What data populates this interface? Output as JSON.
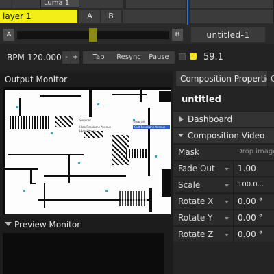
{
  "layer_strip": {
    "clip_label": "Luma 1",
    "layer_name": "layer 1",
    "button_a": "A",
    "button_b": "B"
  },
  "crossfader": {
    "side_a": "A",
    "side_b": "B",
    "composition_name": "untitled-1"
  },
  "tempo": {
    "bpm_label": "BPM",
    "bpm_value": "120.000",
    "minus": "-",
    "plus": "+",
    "tap": "Tap",
    "resync": "Resync",
    "pause": "Pause",
    "fps": "59.1"
  },
  "output_monitor": {
    "title": "Output Monitor",
    "menu_items": [
      "Services",
      "Hide Resolume Avenue",
      "Hide Others",
      "Show All",
      "Quit Resolume Avenue"
    ]
  },
  "preview_monitor": {
    "title": "Preview Monitor"
  },
  "properties": {
    "tab_active": "Composition Properties",
    "tab_next": "C",
    "comp_title": "untitled",
    "dashboard": "Dashboard",
    "comp_video": "Composition Video",
    "rows": [
      {
        "label": "Mask",
        "value": "Drop image"
      },
      {
        "label": "Fade Out",
        "value": "1.00"
      },
      {
        "label": "Scale",
        "value": "100.0..."
      },
      {
        "label": "Rotate X",
        "value": "0.00 °"
      },
      {
        "label": "Rotate Y",
        "value": "0.00 °"
      },
      {
        "label": "Rotate Z",
        "value": "0.00 °"
      }
    ]
  },
  "colors": {
    "accent_yellow": "#f3ee18",
    "fader_handle": "#8a8a1a",
    "accent_blue": "#2a72d6"
  }
}
